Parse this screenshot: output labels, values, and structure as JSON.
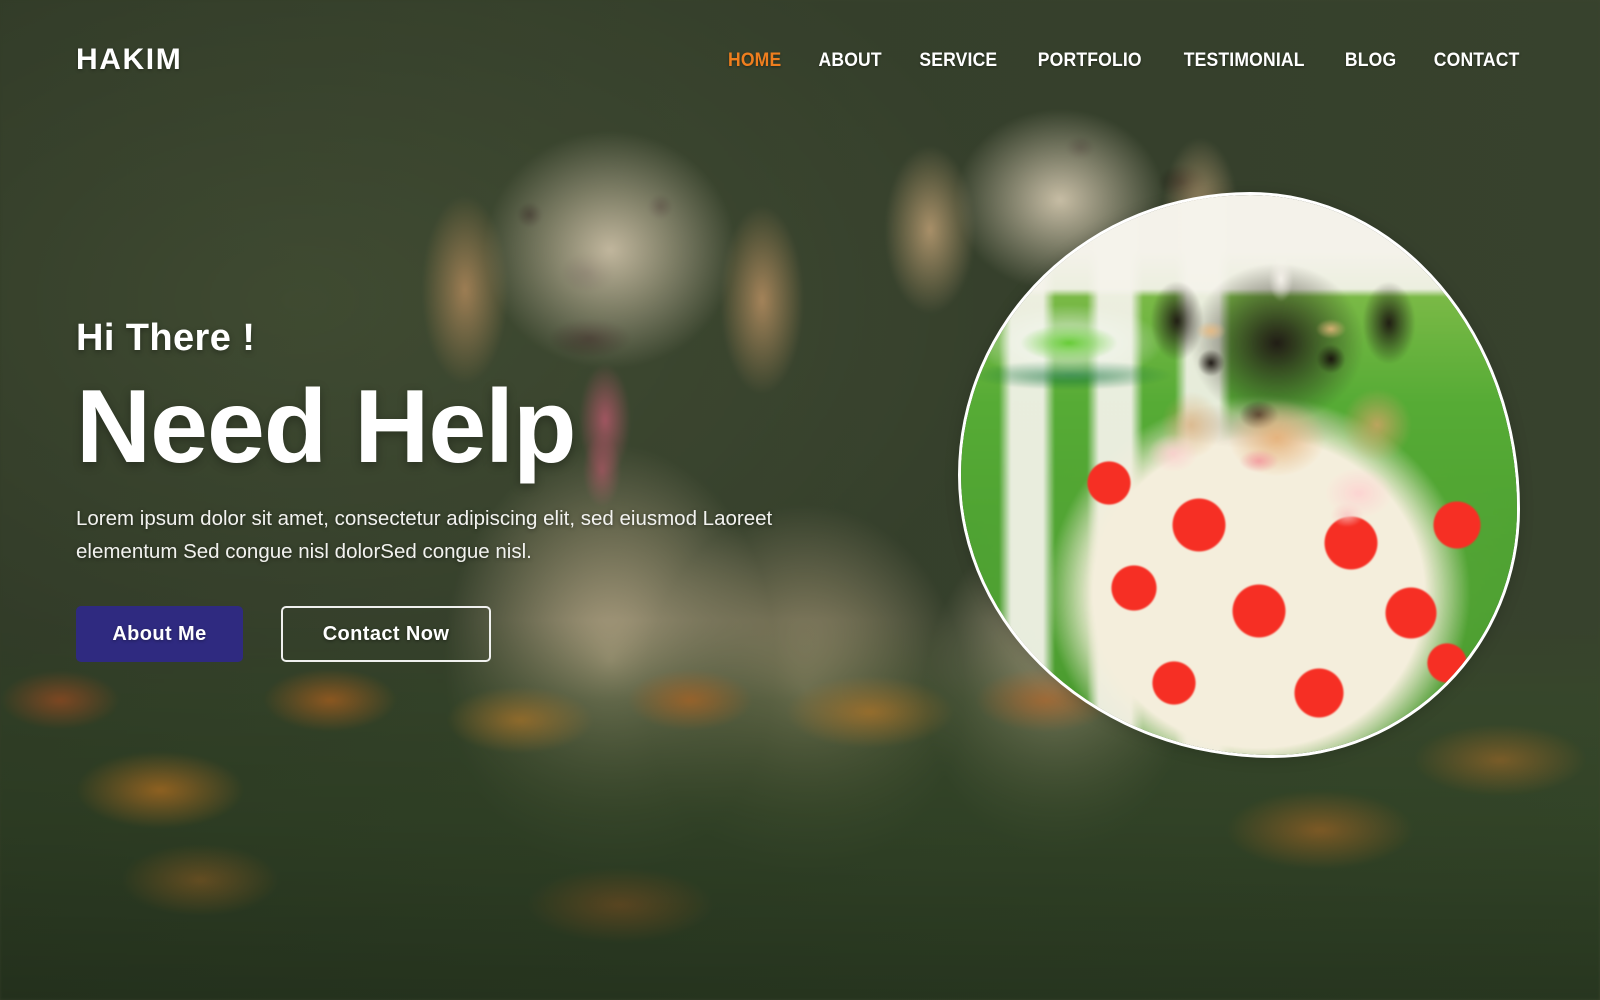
{
  "header": {
    "brand": "HAKIM",
    "nav": [
      {
        "label": "HOME",
        "active": true
      },
      {
        "label": "ABOUT",
        "active": false
      },
      {
        "label": "SERVICE",
        "active": false
      },
      {
        "label": "PORTFOLIO",
        "active": false
      },
      {
        "label": "TESTIMONIAL",
        "active": false
      },
      {
        "label": "BLOG",
        "active": false
      },
      {
        "label": "CONTACT",
        "active": false
      }
    ]
  },
  "hero": {
    "greeting": "Hi There !",
    "title": "Need Help",
    "description": "Lorem ipsum dolor sit amet, consectetur adipiscing elit, sed eiusmod Laoreet elementum Sed congue nisl dolorSed congue nisl.",
    "primary_button": "About Me",
    "secondary_button": "Contact Now",
    "figure_alt": "puppy-in-polka-dot-cup-photo",
    "background_alt": "two-golden-retriever-puppies-on-grass-photo"
  },
  "colors": {
    "accent_orange": "#ef7e1e",
    "primary_button": "#2f2a80",
    "text_light": "#ffffff",
    "backdrop_green": "#4a5538"
  }
}
